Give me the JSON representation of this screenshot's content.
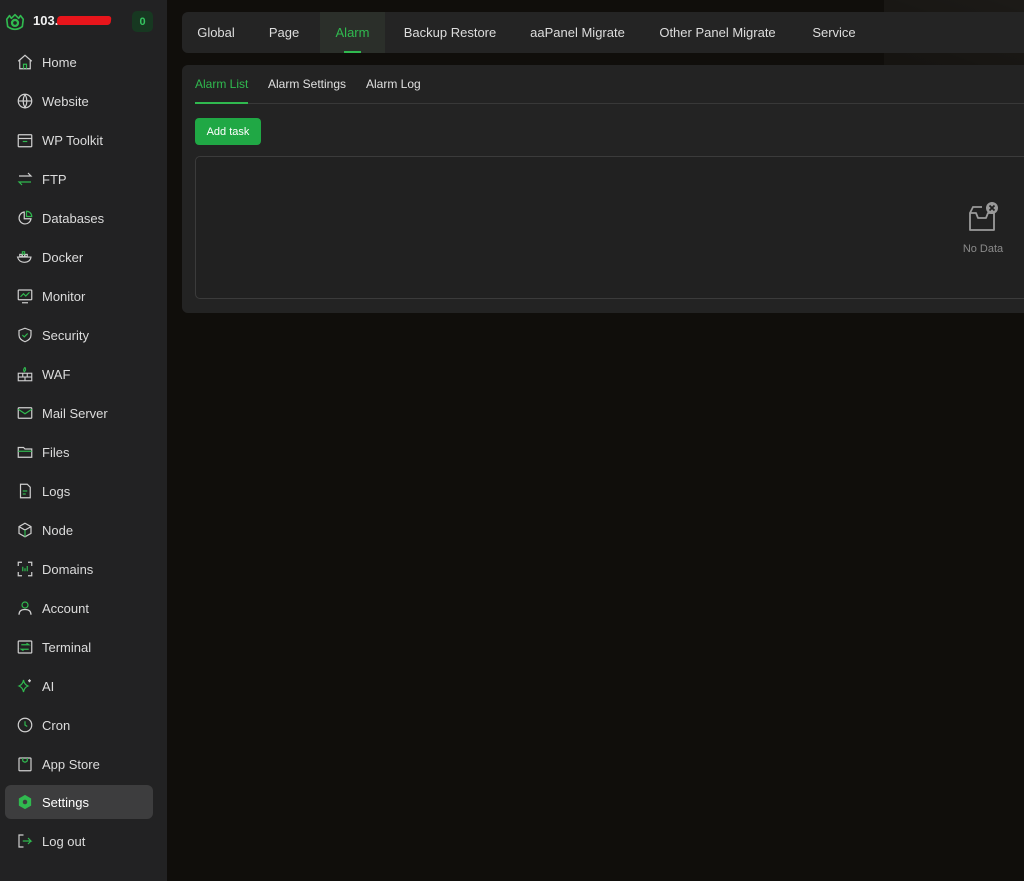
{
  "brand": {
    "host": "103.…",
    "badge": "0",
    "accent": "#30b94f"
  },
  "sidebar": {
    "items": [
      {
        "label": "Home",
        "icon": "home-icon",
        "active": false
      },
      {
        "label": "Website",
        "icon": "globe-icon",
        "active": false
      },
      {
        "label": "WP Toolkit",
        "icon": "toolbox-icon",
        "active": false
      },
      {
        "label": "FTP",
        "icon": "transfer-arrows-icon",
        "active": false
      },
      {
        "label": "Databases",
        "icon": "pie-chart-icon",
        "active": false
      },
      {
        "label": "Docker",
        "icon": "docker-icon",
        "active": false
      },
      {
        "label": "Monitor",
        "icon": "monitor-icon",
        "active": false
      },
      {
        "label": "Security",
        "icon": "shield-icon",
        "active": false
      },
      {
        "label": "WAF",
        "icon": "firewall-icon",
        "active": false
      },
      {
        "label": "Mail Server",
        "icon": "mail-icon",
        "active": false
      },
      {
        "label": "Files",
        "icon": "folder-icon",
        "active": false
      },
      {
        "label": "Logs",
        "icon": "log-file-icon",
        "active": false
      },
      {
        "label": "Node",
        "icon": "cube-icon",
        "active": false
      },
      {
        "label": "Domains",
        "icon": "domain-scan-icon",
        "active": false
      },
      {
        "label": "Account",
        "icon": "user-icon",
        "active": false
      },
      {
        "label": "Terminal",
        "icon": "terminal-icon",
        "active": false
      },
      {
        "label": "AI",
        "icon": "sparkle-icon",
        "active": false
      },
      {
        "label": "Cron",
        "icon": "clock-icon",
        "active": false
      },
      {
        "label": "App Store",
        "icon": "store-bag-icon",
        "active": false
      },
      {
        "label": "Settings",
        "icon": "settings-gear-icon",
        "active": true
      },
      {
        "label": "Log out",
        "icon": "logout-icon",
        "active": false
      }
    ]
  },
  "top_tabs": [
    {
      "label": "Global",
      "active": false
    },
    {
      "label": "Page",
      "active": false
    },
    {
      "label": "Alarm",
      "active": true
    },
    {
      "label": "Backup Restore",
      "active": false
    },
    {
      "label": "aaPanel Migrate",
      "active": false
    },
    {
      "label": "Other Panel Migrate",
      "active": false
    },
    {
      "label": "Service",
      "active": false
    }
  ],
  "sub_tabs": [
    {
      "label": "Alarm List",
      "active": true
    },
    {
      "label": "Alarm Settings",
      "active": false
    },
    {
      "label": "Alarm Log",
      "active": false
    }
  ],
  "content": {
    "add_button": "Add task",
    "empty_text": "No Data",
    "empty_icon": "empty-inbox-icon"
  }
}
